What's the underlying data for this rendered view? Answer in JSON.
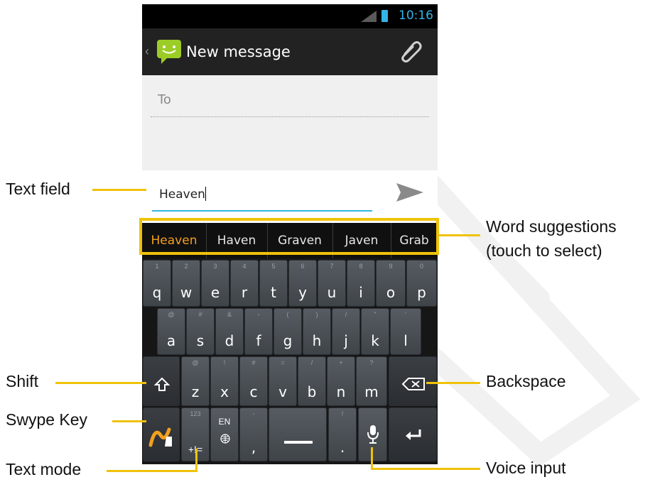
{
  "status_bar": {
    "time": "10:16"
  },
  "action_bar": {
    "title": "New message"
  },
  "compose": {
    "to_label": "To",
    "text_value": "Heaven"
  },
  "suggestions": [
    "Heaven",
    "Haven",
    "Graven",
    "Javen",
    "Grab"
  ],
  "keyboard": {
    "row1": [
      {
        "m": "q",
        "h": "1"
      },
      {
        "m": "w",
        "h": "2"
      },
      {
        "m": "e",
        "h": "3"
      },
      {
        "m": "r",
        "h": "4"
      },
      {
        "m": "t",
        "h": "5"
      },
      {
        "m": "y",
        "h": "6"
      },
      {
        "m": "u",
        "h": "7"
      },
      {
        "m": "i",
        "h": "8"
      },
      {
        "m": "o",
        "h": "9"
      },
      {
        "m": "p",
        "h": "0"
      }
    ],
    "row2": [
      {
        "m": "a",
        "h": "@"
      },
      {
        "m": "s",
        "h": "#"
      },
      {
        "m": "d",
        "h": "&"
      },
      {
        "m": "f",
        "h": "-"
      },
      {
        "m": "g",
        "h": "("
      },
      {
        "m": "h",
        "h": ")"
      },
      {
        "m": "j",
        "h": "/"
      },
      {
        "m": "k",
        "h": "\""
      },
      {
        "m": "l",
        "h": "'"
      }
    ],
    "row3": [
      {
        "m": "z",
        "h": "@"
      },
      {
        "m": "x",
        "h": "!"
      },
      {
        "m": "c",
        "h": "#"
      },
      {
        "m": "v",
        "h": "="
      },
      {
        "m": "b",
        "h": "/"
      },
      {
        "m": "n",
        "h": "+"
      },
      {
        "m": "m",
        "h": "?"
      }
    ],
    "mode_key": {
      "hint": "123",
      "label": "+!="
    },
    "lang_key": {
      "label": "EN"
    },
    "comma_key": {
      "label": ",",
      "hint": "-"
    },
    "period_key": {
      "label": ".",
      "hint": "!"
    }
  },
  "annotations": {
    "text_field": "Text field",
    "word_suggestions_1": "Word suggestions",
    "word_suggestions_2": "(touch to select)",
    "shift": "Shift",
    "backspace": "Backspace",
    "swype_key": "Swype Key",
    "text_mode": "Text mode",
    "voice_input": "Voice input"
  },
  "colors": {
    "accent": "#33b5e5",
    "annotation": "#f0c20a",
    "suggestion_selected": "#f2a01e"
  }
}
